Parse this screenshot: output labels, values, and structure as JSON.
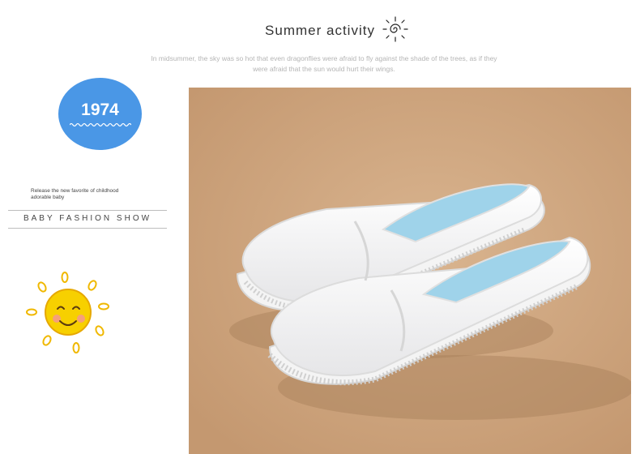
{
  "header": {
    "title": "Summer activity",
    "subtitle_line1": "In midsummer, the sky was so hot that even dragonflies were afraid to fly against the shade of the trees, as if they",
    "subtitle_line2": "were afraid that the sun would hurt their wings."
  },
  "badge": {
    "year": "1974",
    "color": "#4a97e6"
  },
  "side": {
    "release_line1": "Release the new favorite of childhood",
    "release_line2": "adorable baby",
    "show_label": "BABY FASHION SHOW"
  },
  "icons": {
    "title_icon": "sun-spiral-icon",
    "smiley": "smiling-sun-icon",
    "sun_color": "#f5c800"
  },
  "photo": {
    "subject": "white canvas slip-on shoes",
    "background_color": "#cfa781"
  }
}
